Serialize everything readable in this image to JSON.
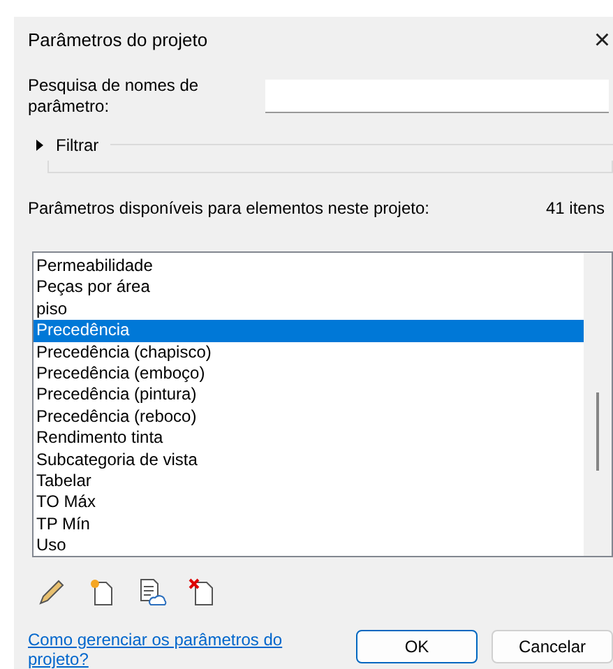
{
  "window": {
    "title": "Parâmetros do projeto",
    "close": "×"
  },
  "search": {
    "label": "Pesquisa de nomes de parâmetro:"
  },
  "filter": {
    "label": "Filtrar",
    "expanded": false
  },
  "available": {
    "label": "Parâmetros disponíveis para elementos neste projeto:",
    "count": "41 itens"
  },
  "parameters": [
    {
      "label": "Permeabilidade",
      "selected": false
    },
    {
      "label": "Peças por área",
      "selected": false
    },
    {
      "label": "piso",
      "selected": false
    },
    {
      "label": "Precedência",
      "selected": true
    },
    {
      "label": "Precedência (chapisco)",
      "selected": false
    },
    {
      "label": "Precedência (emboço)",
      "selected": false
    },
    {
      "label": "Precedência (pintura)",
      "selected": false
    },
    {
      "label": "Precedência (reboco)",
      "selected": false
    },
    {
      "label": "Rendimento tinta",
      "selected": false
    },
    {
      "label": "Subcategoria de vista",
      "selected": false
    },
    {
      "label": "Tabelar",
      "selected": false
    },
    {
      "label": "TO Máx",
      "selected": false
    },
    {
      "label": "TP Mín",
      "selected": false
    },
    {
      "label": "Uso",
      "selected": false
    }
  ],
  "tools": [
    {
      "kind": "edit"
    },
    {
      "kind": "new"
    },
    {
      "kind": "cloud"
    },
    {
      "kind": "delete"
    }
  ],
  "help_link": "Como gerenciar os parâmetros do projeto?",
  "buttons": [
    {
      "label": "OK",
      "kind": "default"
    },
    {
      "label": "Cancelar",
      "kind": "normal"
    }
  ]
}
